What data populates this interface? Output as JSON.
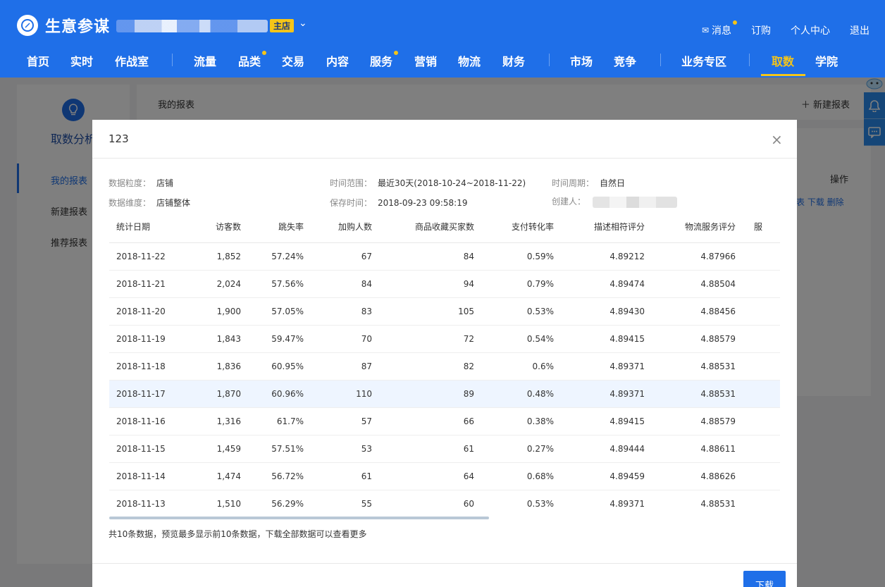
{
  "header": {
    "app_name": "生意参谋",
    "shop_badge": "主店",
    "top_links": [
      {
        "label": "消息",
        "icon": "mail-icon",
        "has_dot": true
      },
      {
        "label": "订购"
      },
      {
        "label": "个人中心"
      },
      {
        "label": "退出"
      }
    ],
    "nav": [
      {
        "label": "首页"
      },
      {
        "label": "实时"
      },
      {
        "label": "作战室"
      },
      {
        "label": "流量"
      },
      {
        "label": "品类",
        "has_dot": true
      },
      {
        "label": "交易"
      },
      {
        "label": "内容"
      },
      {
        "label": "服务",
        "has_dot": true
      },
      {
        "label": "营销"
      },
      {
        "label": "物流"
      },
      {
        "label": "财务"
      },
      {
        "label": "市场"
      },
      {
        "label": "竞争"
      },
      {
        "label": "业务专区"
      },
      {
        "label": "取数",
        "active": true
      },
      {
        "label": "学院"
      }
    ],
    "accent_color": "#1f6fe8",
    "active_color": "#f5c518"
  },
  "background": {
    "sidebar_title": "取数分析",
    "sidebar_items": [
      "我的报表",
      "新建报表",
      "推荐报表"
    ],
    "main_title": "我的报表",
    "new_report": "＋ 新建报表",
    "op_header": "操作",
    "op_links": "表 下载 删除"
  },
  "modal": {
    "title": "123",
    "meta": {
      "granularity_label": "数据粒度：",
      "granularity_value": "店铺",
      "range_label": "时间范围：",
      "range_value": "最近30天(2018-10-24~2018-11-22)",
      "period_label": "时间周期：",
      "period_value": "自然日",
      "dimension_label": "数据维度：",
      "dimension_value": "店铺整体",
      "saved_label": "保存时间：",
      "saved_value": "2018-09-23 09:58:19",
      "creator_label": "创建人："
    },
    "table": {
      "columns": [
        "统计日期",
        "访客数",
        "跳失率",
        "加购人数",
        "商品收藏买家数",
        "支付转化率",
        "描述相符评分",
        "物流服务评分",
        "服"
      ],
      "rows": [
        [
          "2018-11-22",
          "1,852",
          "57.24%",
          "67",
          "84",
          "0.59%",
          "4.89212",
          "4.87966"
        ],
        [
          "2018-11-21",
          "2,024",
          "57.56%",
          "84",
          "94",
          "0.79%",
          "4.89474",
          "4.88504"
        ],
        [
          "2018-11-20",
          "1,900",
          "57.05%",
          "83",
          "105",
          "0.53%",
          "4.89430",
          "4.88456"
        ],
        [
          "2018-11-19",
          "1,843",
          "59.47%",
          "70",
          "72",
          "0.54%",
          "4.89415",
          "4.88579"
        ],
        [
          "2018-11-18",
          "1,836",
          "60.95%",
          "87",
          "82",
          "0.6%",
          "4.89371",
          "4.88531"
        ],
        [
          "2018-11-17",
          "1,870",
          "60.96%",
          "110",
          "89",
          "0.48%",
          "4.89371",
          "4.88531"
        ],
        [
          "2018-11-16",
          "1,316",
          "61.7%",
          "57",
          "66",
          "0.38%",
          "4.89415",
          "4.88579"
        ],
        [
          "2018-11-15",
          "1,459",
          "57.51%",
          "53",
          "61",
          "0.27%",
          "4.89444",
          "4.88611"
        ],
        [
          "2018-11-14",
          "1,474",
          "56.72%",
          "61",
          "64",
          "0.68%",
          "4.89459",
          "4.88626"
        ],
        [
          "2018-11-13",
          "1,510",
          "56.29%",
          "55",
          "60",
          "0.53%",
          "4.89371",
          "4.88531"
        ]
      ],
      "highlighted_row": 5
    },
    "footer_note": "共10条数据，预览最多显示前10条数据，下载全部数据可以查看更多",
    "download_label": "下载"
  }
}
